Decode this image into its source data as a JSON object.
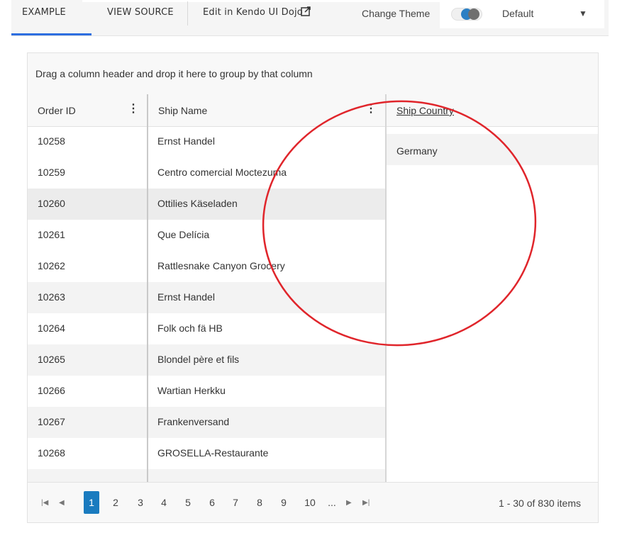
{
  "tabs": {
    "example": "EXAMPLE",
    "view_source": "VIEW SOURCE",
    "edit_dojo": "Edit in Kendo UI Dojo",
    "change_theme": "Change Theme",
    "theme_value": "Default"
  },
  "grid": {
    "group_hint": "Drag a column header and drop it here to group by that column",
    "columns": [
      "Order ID",
      "Ship Name",
      "Ship Country"
    ],
    "rows": [
      {
        "id": "10258",
        "ship": "Ernst Handel"
      },
      {
        "id": "10259",
        "ship": "Centro comercial Moctezuma"
      },
      {
        "id": "10260",
        "ship": "Ottilies Käseladen"
      },
      {
        "id": "10261",
        "ship": "Que Delícia"
      },
      {
        "id": "10262",
        "ship": "Rattlesnake Canyon Grocery"
      },
      {
        "id": "10263",
        "ship": "Ernst Handel"
      },
      {
        "id": "10264",
        "ship": "Folk och fä HB"
      },
      {
        "id": "10265",
        "ship": "Blondel père et fils"
      },
      {
        "id": "10266",
        "ship": "Wartian Herkku"
      },
      {
        "id": "10267",
        "ship": "Frankenversand"
      },
      {
        "id": "10268",
        "ship": "GROSELLA-Restaurante"
      }
    ],
    "country_value": "Germany"
  },
  "pager": {
    "pages": [
      "1",
      "2",
      "3",
      "4",
      "5",
      "6",
      "7",
      "8",
      "9",
      "10",
      "..."
    ],
    "current_page": "1",
    "info": "1 - 30 of 830 items"
  },
  "colors": {
    "accent": "#1a7bbf",
    "tab_underline": "#2d6ee0",
    "annotation": "#e0252b"
  }
}
